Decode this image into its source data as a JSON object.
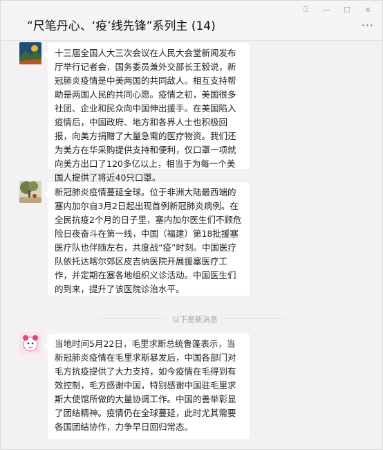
{
  "window": {
    "title": "“尺笔丹心、‘疫’线先锋”系列主 (14)",
    "controls": [
      {
        "name": "pin-icon",
        "glyph": "⍗"
      },
      {
        "name": "minimize-icon",
        "glyph": "—"
      },
      {
        "name": "maximize-icon",
        "glyph": "☐"
      },
      {
        "name": "close-icon",
        "glyph": "✕"
      }
    ],
    "more_glyph": "···"
  },
  "messages": [
    {
      "avatar": "avatar-landscape-painting",
      "text": "十三届全国人大三次会议在人民大会堂新闻发布厅举行记者会，国务委员兼外交部长王毅说，新冠肺炎疫情是中美两国的共同敌人。相互支持帮助是两国人民的共同心愿。疫情之初，美国很多社团、企业和民众向中国伸出援手。在美国陷入疫情后，中国政府、地方和各界人士也积极回报，向美方捐赠了大量急需的医疗物资。我们还为美方在华采购提供支持和便利，仅口罩一项就向美方出口了120多亿以上，相当于为每一个美国人提供了将近40只口罩。"
    },
    {
      "avatar": "avatar-tree-photo",
      "text": "新冠肺炎疫情蔓延全球。位于非洲大陆最西端的塞内加尔自3月2日起出现首例新冠肺炎病例。在全民抗疫2个月的日子里，塞内加尔医生们不顾危险日夜奋斗在第一线，中国（福建）第18批援塞医疗队也伴随左右，共度战“疫”时刻。中国医疗队依托达喀尔郊区皮吉纳医院开展援塞医疗工作，并定期在塞各地组织义诊活动。中国医生们的到来，提升了该医院诊治水平。"
    },
    {
      "avatar": "avatar-cartoon-pink",
      "text": "当地时间5月22日，毛里求斯总统鲁蓬表示，当新冠肺炎疫情在毛里求斯暴发后，中国各部门对毛方抗疫提供了大力支持，如今疫情在毛得到有效控制，毛方感谢中国，特别感谢中国驻毛里求斯大使馆所做的大量协调工作。中国的善举彰显了团结精神。疫情仍在全球蔓延，此时尤其需要各国团结协作，力争早日回归常态。"
    }
  ],
  "divider_label": "以下是新消息"
}
